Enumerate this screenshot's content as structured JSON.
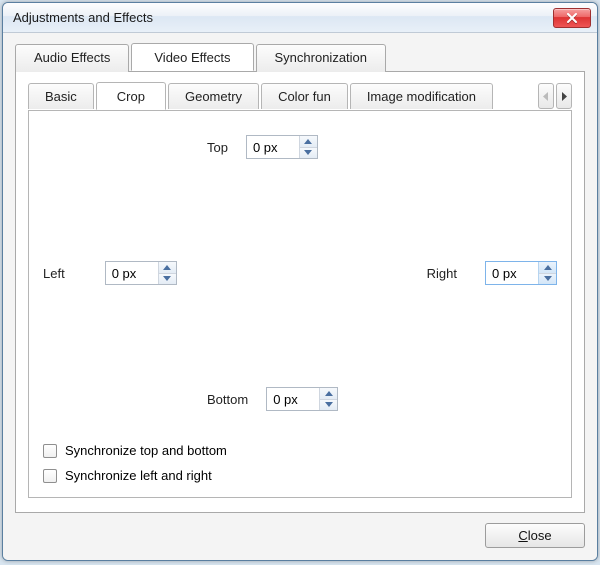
{
  "window": {
    "title": "Adjustments and Effects"
  },
  "outer_tabs": {
    "audio": "Audio Effects",
    "video": "Video Effects",
    "sync": "Synchronization",
    "active": "video"
  },
  "inner_tabs": {
    "basic": "Basic",
    "crop": "Crop",
    "geometry": "Geometry",
    "colorfun": "Color fun",
    "imagemod": "Image modification",
    "active": "crop"
  },
  "crop": {
    "top": {
      "label": "Top",
      "value": "0 px"
    },
    "left": {
      "label": "Left",
      "value": "0 px"
    },
    "right": {
      "label": "Right",
      "value": "0 px"
    },
    "bottom": {
      "label": "Bottom",
      "value": "0 px"
    },
    "sync_tb": {
      "label": "Synchronize top and bottom",
      "checked": false
    },
    "sync_lr": {
      "label": "Synchronize left and right",
      "checked": false
    }
  },
  "footer": {
    "close_label": "Close",
    "close_accel_index": 0
  }
}
